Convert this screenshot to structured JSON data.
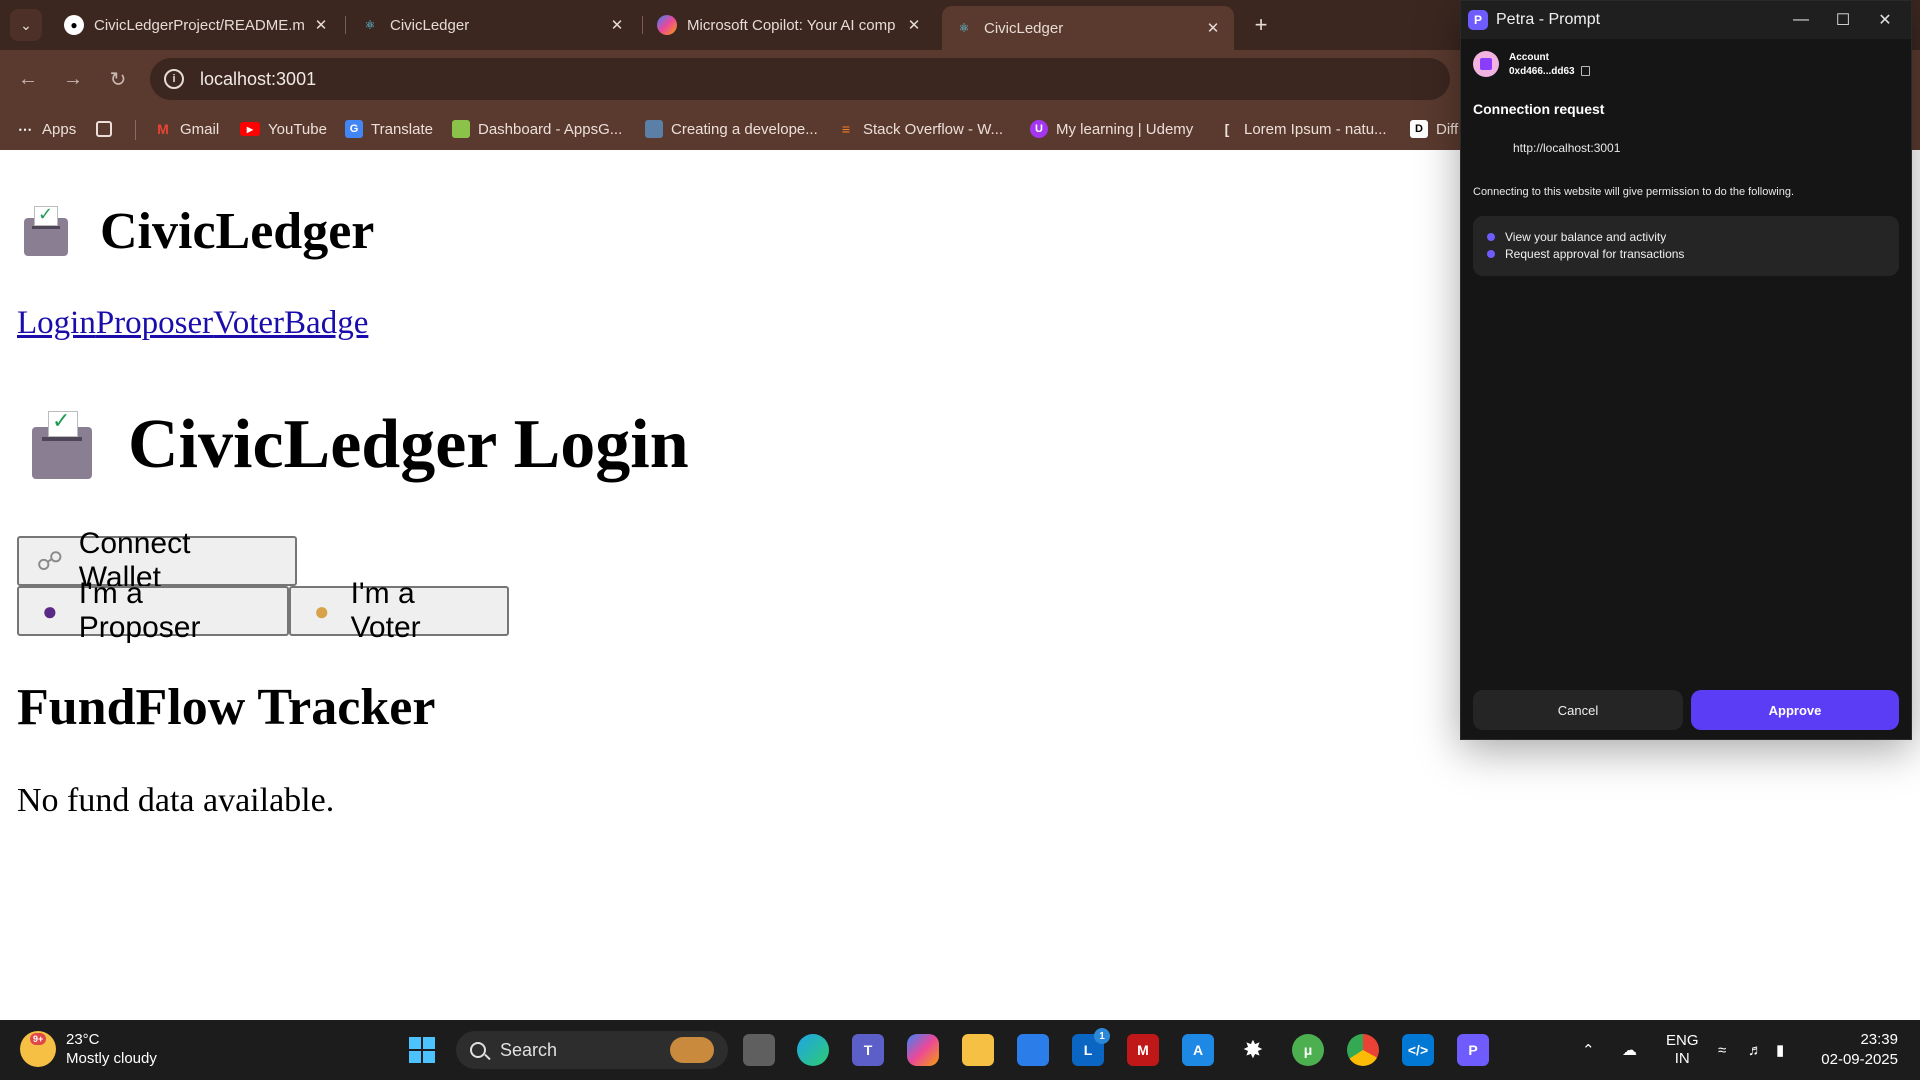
{
  "browser": {
    "tabs": [
      {
        "title": "CivicLedgerProject/README.md",
        "favicon": "github-icon"
      },
      {
        "title": "CivicLedger",
        "favicon": "react-icon"
      },
      {
        "title": "Microsoft Copilot: Your AI comp",
        "favicon": "copilot-icon"
      },
      {
        "title": "CivicLedger",
        "favicon": "react-icon",
        "active": true
      }
    ],
    "url": "localhost:3001",
    "bookmarks": [
      "Apps",
      "Gmail",
      "YouTube",
      "Translate",
      "Dashboard - AppsG...",
      "Creating a develope...",
      "Stack Overflow - W...",
      "My learning | Udemy",
      "Lorem Ipsum - natu...",
      "Diff"
    ]
  },
  "page": {
    "app_title": "CivicLedger",
    "nav_links": [
      "Login",
      "Proposer",
      "Voter",
      "Badge"
    ],
    "login_title": "CivicLedger Login",
    "connect_wallet": "Connect Wallet",
    "proposer_button": "I'm a Proposer",
    "voter_button": "I'm a Voter",
    "fundflow_title": "FundFlow Tracker",
    "fund_message": "No fund data available."
  },
  "petra": {
    "window_title": "Petra - Prompt",
    "account_label": "Account",
    "account_address": "0xd466...dd63",
    "connection_title": "Connection request",
    "connection_url": "http://localhost:3001",
    "description": "Connecting to this website will give permission to do the following.",
    "permissions": [
      "View your balance and activity",
      "Request approval for transactions"
    ],
    "cancel": "Cancel",
    "approve": "Approve",
    "accent_color": "#5b3df5"
  },
  "taskbar": {
    "temperature": "23°C",
    "weather": "Mostly cloudy",
    "weather_badge": "9+",
    "search_placeholder": "Search",
    "lang_top": "ENG",
    "lang_bottom": "IN",
    "time": "23:39",
    "date": "02-09-2025",
    "notification_count": "1"
  }
}
